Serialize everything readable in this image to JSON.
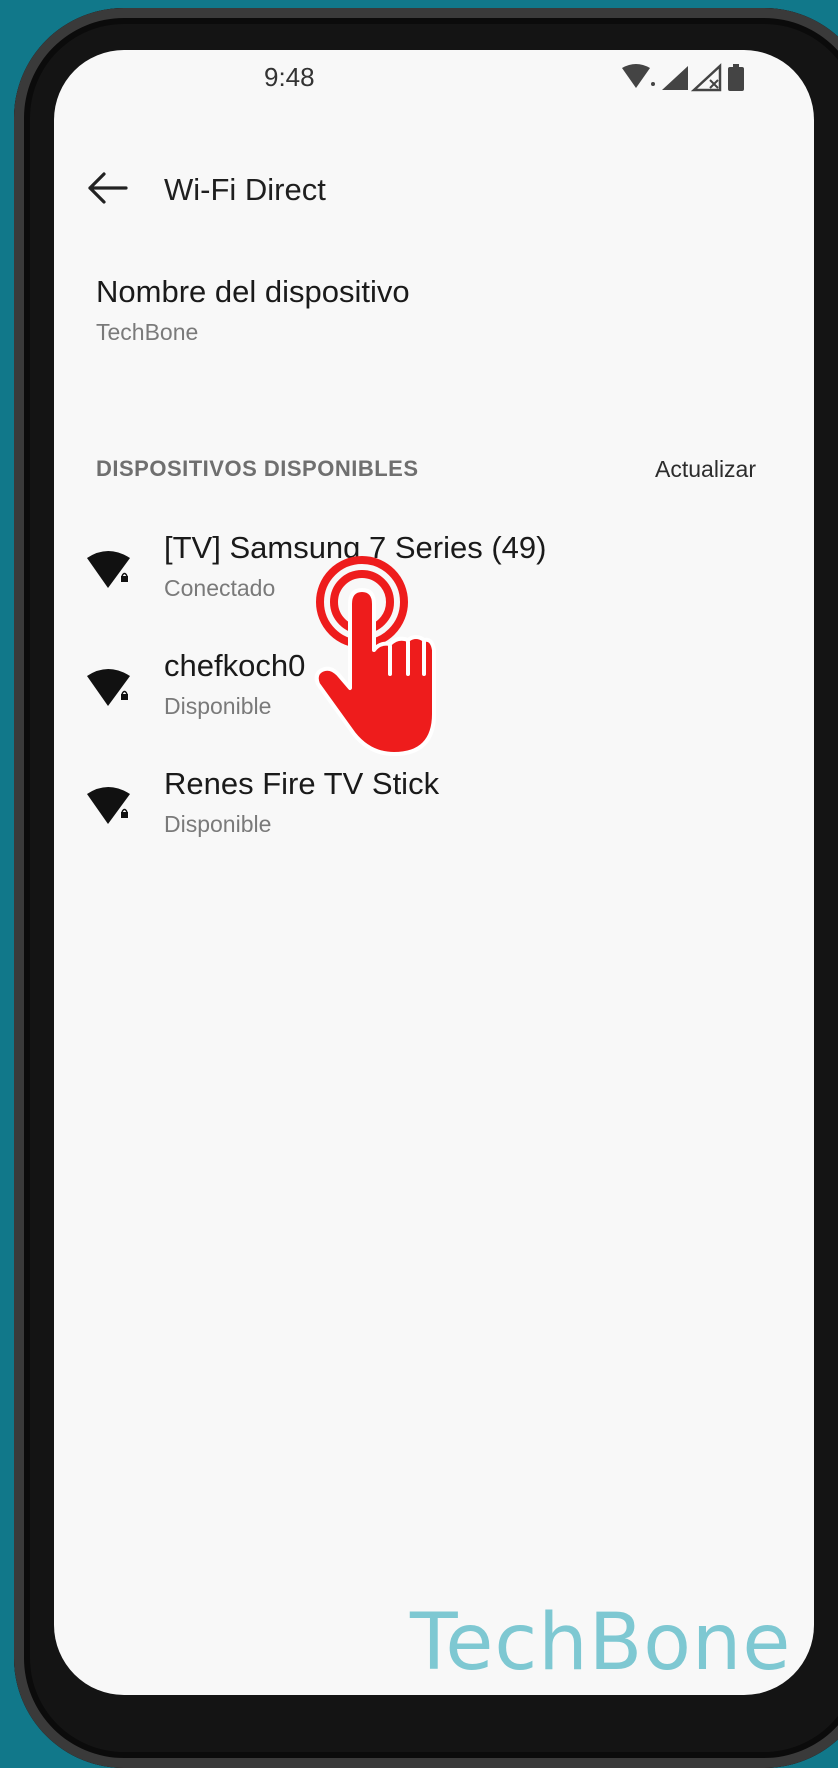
{
  "status_bar": {
    "time": "9:48",
    "icons": [
      "wifi-icon",
      "signal-icon",
      "signal-no-service-icon",
      "battery-icon"
    ]
  },
  "app_bar": {
    "title": "Wi-Fi Direct",
    "back_icon": "arrow-left-icon"
  },
  "device_name": {
    "label": "Nombre del dispositivo",
    "value": "TechBone"
  },
  "available_devices": {
    "header": "DISPOSITIVOS DISPONIBLES",
    "refresh_label": "Actualizar",
    "items": [
      {
        "name": "[TV] Samsung 7 Series (49)",
        "status": "Conectado",
        "icon": "wifi-lock-icon"
      },
      {
        "name": "chefkoch0",
        "status": "Disponible",
        "icon": "wifi-lock-icon"
      },
      {
        "name": "Renes Fire TV Stick",
        "status": "Disponible",
        "icon": "wifi-lock-icon"
      }
    ]
  },
  "overlay": {
    "icon": "tap-hand-icon",
    "color": "#ee1c1c"
  },
  "watermark": "TechBone",
  "colors": {
    "background": "#11788a",
    "screen": "#f8f8f8",
    "watermark": "#7ec8d2"
  }
}
